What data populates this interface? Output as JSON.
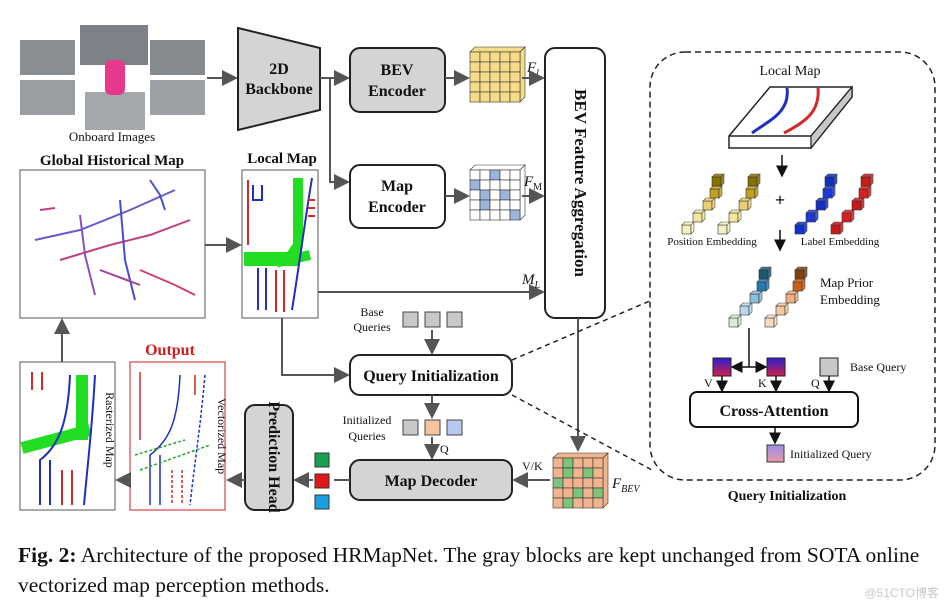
{
  "inputs": {
    "onboard_images": "Onboard Images"
  },
  "blocks": {
    "backbone_line1": "2D",
    "backbone_line2": "Backbone",
    "bev_encoder_line1": "BEV",
    "bev_encoder_line2": "Encoder",
    "map_encoder_line1": "Map",
    "map_encoder_line2": "Encoder",
    "bev_aggregation": "BEV Feature Aggregation",
    "query_init": "Query Initialization",
    "map_decoder": "Map Decoder",
    "prediction_head": "Prediction Head"
  },
  "labels": {
    "global_map": "Global Historical Map",
    "local_map": "Local Map",
    "f_l": "F",
    "f_l_sub": "l",
    "f_m": "F",
    "f_m_sub": "M",
    "m_l": "M",
    "m_l_sub": "L",
    "f_bev": "F",
    "f_bev_sub": "BEV",
    "base_queries_1": "Base",
    "base_queries_2": "Queries",
    "initialized_queries_1": "Initialized",
    "initialized_queries_2": "Queries",
    "q": "Q",
    "vk": "V/K",
    "output": "Output",
    "rasterized_map": "Rasterized Map",
    "vectorized_map": "Vectorized Map"
  },
  "detail_panel": {
    "title": "Query Initialization",
    "local_map": "Local Map",
    "plus": "+",
    "position_embedding": "Position Embedding",
    "label_embedding": "Label Embedding",
    "map_prior_1": "Map Prior",
    "map_prior_2": "Embedding",
    "v": "V",
    "k": "K",
    "q": "Q",
    "base_query": "Base Query",
    "cross_attention": "Cross-Attention",
    "initialized_query": "Initialized Query"
  },
  "caption": {
    "prefix": "Fig. 2:",
    "text": " Architecture of the proposed HRMapNet. The gray blocks are kept unchanged from SOTA online vectorized map perception methods."
  },
  "watermark": "@51CTO博客",
  "colors": {
    "gray_block": "#d4d4d4",
    "output_red": "#cc1f1f",
    "lane_red": "#d42a2a",
    "lane_blue": "#1f2fbf",
    "green": "#22dd22"
  }
}
